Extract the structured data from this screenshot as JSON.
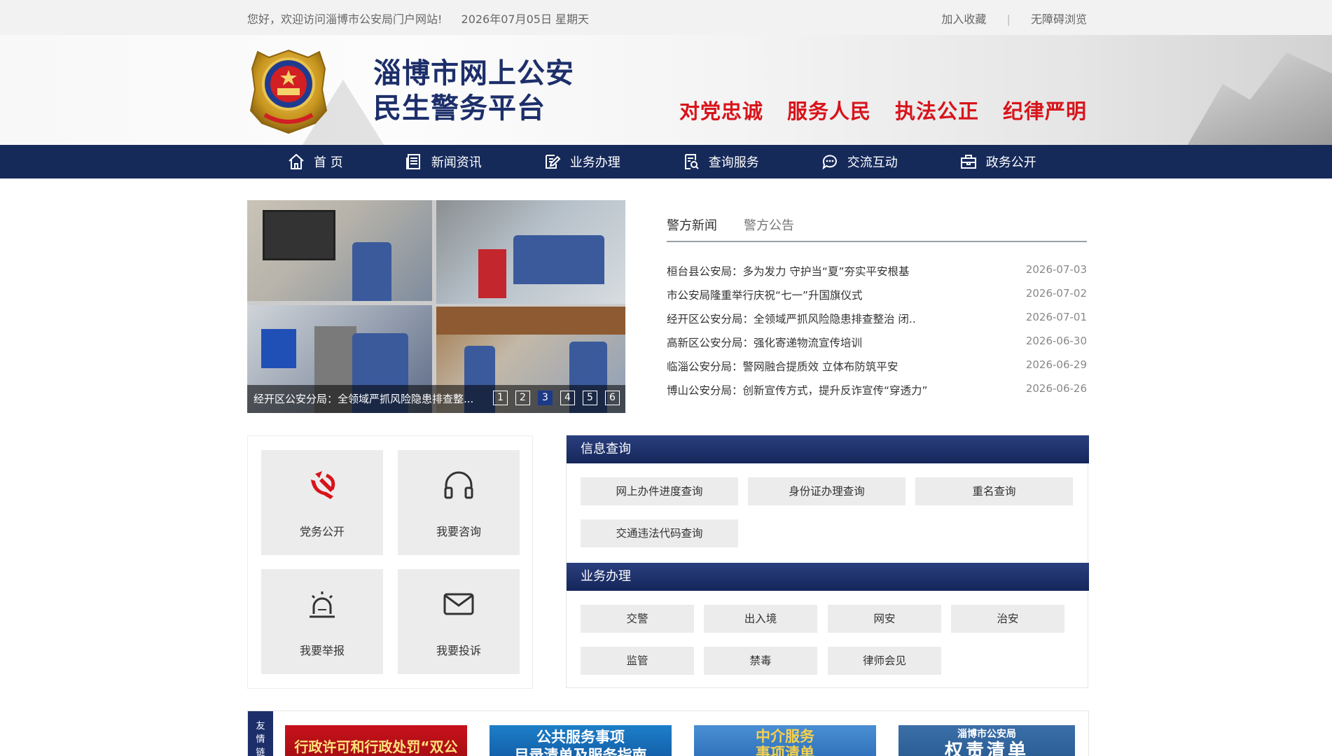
{
  "topbar": {
    "welcome": "您好，欢迎访问淄博市公安局门户网站!",
    "date": "2026年07月05日 星期天",
    "bookmark": "加入收藏",
    "separator": "|",
    "accessible": "无障碍浏览"
  },
  "header": {
    "title_line1": "淄博市网上公安",
    "title_line2": "民生警务平台",
    "slogans": [
      "对党忠诚",
      "服务人民",
      "执法公正",
      "纪律严明"
    ]
  },
  "nav": {
    "items": [
      {
        "label": "首 页",
        "icon": "home-icon"
      },
      {
        "label": "新闻资讯",
        "icon": "newspaper-icon"
      },
      {
        "label": "业务办理",
        "icon": "edit-icon"
      },
      {
        "label": "查询服务",
        "icon": "search-doc-icon"
      },
      {
        "label": "交流互动",
        "icon": "chat-icon"
      },
      {
        "label": "政务公开",
        "icon": "briefcase-icon"
      }
    ]
  },
  "slider": {
    "caption": "经开区公安分局：全领域严抓风险隐患排查整...",
    "pages": [
      "1",
      "2",
      "3",
      "4",
      "5",
      "6"
    ],
    "active_page": "3"
  },
  "news": {
    "tabs": [
      "警方新闻",
      "警方公告"
    ],
    "items": [
      {
        "title": "桓台县公安局：多为发力 守护当“夏”夯实平安根基",
        "date": "2026-07-03"
      },
      {
        "title": "市公安局隆重举行庆祝“七一”升国旗仪式",
        "date": "2026-07-02"
      },
      {
        "title": "经开区公安分局：全领域严抓风险隐患排查整治 闭..",
        "date": "2026-07-01"
      },
      {
        "title": "高新区公安分局：强化寄递物流宣传培训",
        "date": "2026-06-30"
      },
      {
        "title": "临淄公安分局：警网融合提质效 立体布防筑平安",
        "date": "2026-06-29"
      },
      {
        "title": "博山公安分局：创新宣传方式，提升反诈宣传“穿透力”",
        "date": "2026-06-26"
      }
    ]
  },
  "services": [
    {
      "label": "党务公开",
      "icon": "party-emblem-icon"
    },
    {
      "label": "我要咨询",
      "icon": "headset-icon"
    },
    {
      "label": "我要举报",
      "icon": "alarm-light-icon"
    },
    {
      "label": "我要投诉",
      "icon": "envelope-icon"
    }
  ],
  "query": {
    "title": "信息查询",
    "buttons": [
      "网上办件进度查询",
      "身份证办理查询",
      "重名查询",
      "交通违法代码查询"
    ]
  },
  "business": {
    "title": "业务办理",
    "buttons": [
      "交警",
      "出入境",
      "网安",
      "治安",
      "监管",
      "禁毒",
      "律师会见"
    ]
  },
  "links": {
    "side_label": [
      "友",
      "情",
      "链"
    ],
    "banners": [
      {
        "line1": "行政许可和行政处罚“双公示”"
      },
      {
        "line1": "公共服务事项",
        "line2": "目录清单及服务指南"
      },
      {
        "line1": "中介服务",
        "line2": "事项清单"
      },
      {
        "line1": "淄博市公安局",
        "line2": "权责清单"
      }
    ]
  },
  "colors": {
    "navy": "#162a5a",
    "slogan_red": "#d8141b",
    "title_blue": "#1d2f6a",
    "tile_gray": "#ececec"
  }
}
